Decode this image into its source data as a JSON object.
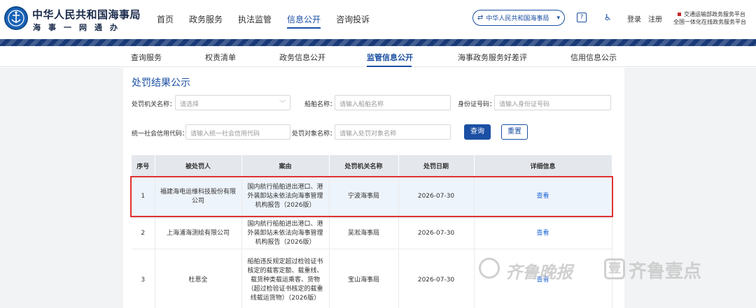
{
  "header": {
    "brand_title": "中华人民共和国海事局",
    "brand_subtitle": "海事一网通办",
    "nav": [
      {
        "label": "首页",
        "active": false
      },
      {
        "label": "政务服务",
        "active": false
      },
      {
        "label": "执法监管",
        "active": false
      },
      {
        "label": "信息公开",
        "active": true
      },
      {
        "label": "咨询投诉",
        "active": false
      }
    ],
    "org_selector": "中华人民共和国海事局",
    "help_icon": "help-icon",
    "accessibility_icon": "accessibility-icon",
    "login": "登录",
    "register": "注册",
    "platform_line1": "交通运输部政务服务平台",
    "platform_line2": "全国一体化在线政务服务平台",
    "accent_color": "#1b4fa3",
    "stripe_color": "#1a3a78"
  },
  "subnav": [
    {
      "label": "查询服务",
      "active": false
    },
    {
      "label": "权责清单",
      "active": false
    },
    {
      "label": "政务信息公开",
      "active": false
    },
    {
      "label": "监管信息公开",
      "active": true
    },
    {
      "label": "海事政务服务好差评",
      "active": false
    },
    {
      "label": "信用信息公示",
      "active": false
    }
  ],
  "section_title": "处罚结果公示",
  "form": {
    "authority_label": "处罚机关名称：",
    "authority_placeholder": "请选择",
    "ship_label": "船舶名称：",
    "ship_placeholder": "请输入船舶名称",
    "id_label": "身份证号码：",
    "id_placeholder": "请输入身份证号码",
    "credit_label": "统一社会信用代码：",
    "credit_placeholder": "请输入统一社会信用代码",
    "target_label": "处罚对象名称：",
    "target_placeholder": "请输入处罚对象名称",
    "search_btn": "查询",
    "reset_btn": "重置"
  },
  "table": {
    "headers": [
      "序号",
      "被处罚人",
      "案由",
      "处罚机关名称",
      "处罚日期",
      "详细信息"
    ],
    "rows": [
      {
        "no": "1",
        "party": "福建海电运维科技股份有限公司",
        "reason": "国内航行船舶进出港口、港外装卸站未依法向海事管理机构报告（2026版）",
        "authority": "宁波海事局",
        "date": "2026-07-30",
        "detail": "查看"
      },
      {
        "no": "2",
        "party": "上海浦海测绘有限公司",
        "reason": "国内航行船舶进出港口、港外装卸站未依法向海事管理机构报告（2026版）",
        "authority": "吴淞海事局",
        "date": "2026-07-30",
        "detail": "查看"
      },
      {
        "no": "3",
        "party": "杜恩全",
        "reason": "船舶违反规定超过检验证书核定的载客定额、载重线、载货种类载运乘客、货物（超过检验证书核定的载重线载运货物）（2026版）",
        "authority": "宝山海事局",
        "date": "2026-07-30",
        "detail": "查看"
      }
    ]
  },
  "watermark": {
    "text1": "齐鲁晚报",
    "box_char": "壹",
    "text2": "齐鲁壹点"
  }
}
